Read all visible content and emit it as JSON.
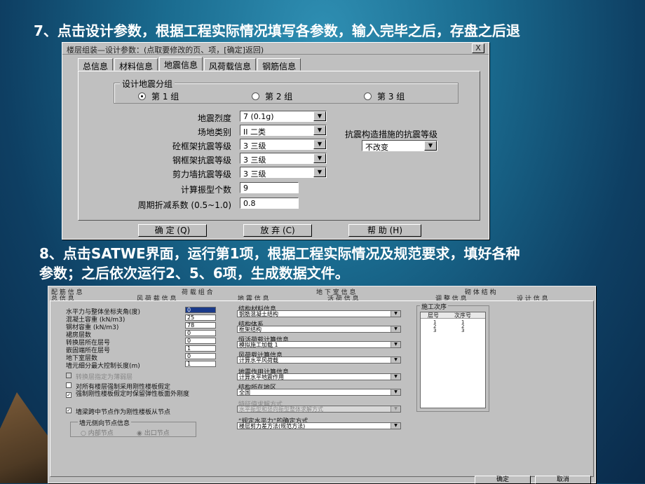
{
  "step7": "7、点击设计参数，根据工程实际情况填写各参数，输入完毕之后，存盘之后退",
  "step8_line1": "8、点击SATWE界面，运行第1项，根据工程实际情况及规范要求，填好各种",
  "step8_line2": "参数；之后依次运行2、5、6项，生成数据文件。",
  "dialog1": {
    "title": "楼层组装—设计参数：(点取要修改的页、项，[确定]返回)",
    "close": "X",
    "tabs": [
      "总信息",
      "材料信息",
      "地震信息",
      "风荷载信息",
      "钢筋信息"
    ],
    "active_tab": "地震信息",
    "group_title": "设计地震分组",
    "radios": [
      "第 1 组",
      "第 2 组",
      "第 3 组"
    ],
    "selected_radio": "第 1 组",
    "fields": [
      {
        "label": "地震烈度",
        "value": "7  (0.1g)"
      },
      {
        "label": "场地类别",
        "value": "II  二类"
      },
      {
        "label": "砼框架抗震等级",
        "value": "3   三级"
      },
      {
        "label": "钢框架抗震等级",
        "value": "3   三级"
      },
      {
        "label": "剪力墙抗震等级",
        "value": "3   三级"
      },
      {
        "label": "计算振型个数",
        "value": "9"
      },
      {
        "label": "周期折减系数 (0.5~1.0)",
        "value": "0.8"
      }
    ],
    "right_label": "抗震构造措施的抗震等级",
    "right_value": "不改变",
    "buttons": [
      "确 定 (Q)",
      "放 弃 (C)",
      "帮 助 (H)"
    ]
  },
  "dialog2": {
    "tabs_top": [
      "配 筋 信 息",
      "荷 载 组 合",
      "地 下 室 信 息",
      "砌 体 结 构"
    ],
    "tabs_bottom": [
      "总 信 息",
      "风 荷 载 信 息",
      "地 震 信 息",
      "活 荷 信 息",
      "调 整 信 息",
      "设 计 信 息"
    ],
    "left_fields": [
      {
        "label": "水平力与整体坐标夹角(度)",
        "value": "0"
      },
      {
        "label": "混凝土容重    (kN/m3)",
        "value": "25"
      },
      {
        "label": "钢材容重      (kN/m3)",
        "value": "78"
      },
      {
        "label": "裙房层数",
        "value": "0"
      },
      {
        "label": "转换层所在层号",
        "value": "0"
      },
      {
        "label": "嵌固端所在层号",
        "value": "1"
      },
      {
        "label": "地下室层数",
        "value": "0"
      },
      {
        "label": "墙元细分最大控制长度(m)",
        "value": "1"
      }
    ],
    "checks": [
      {
        "label": "转换层指定为薄弱层",
        "checked": false,
        "disabled": true
      },
      {
        "label": "对所有楼层强制采用刚性楼板假定",
        "checked": false,
        "disabled": false
      },
      {
        "label": "强制刚性楼板假定时保留弹性板面外刚度",
        "checked": true,
        "disabled": false
      },
      {
        "label": "墙梁跨中节点作为刚性楼板从节点",
        "checked": true,
        "disabled": false
      }
    ],
    "wall_group_title": "墙元侧向节点信息",
    "wall_radios": [
      "内部节点",
      "出口节点"
    ],
    "combos": [
      {
        "label": "结构材料信息",
        "value": "钢筋混凝土结构",
        "disabled": false
      },
      {
        "label": "结构体系",
        "value": "框架结构",
        "disabled": false
      },
      {
        "label": "恒活荷载计算信息",
        "value": "模拟施工加载 1",
        "disabled": false
      },
      {
        "label": "风荷载计算信息",
        "value": "计算水平风荷载",
        "disabled": false
      },
      {
        "label": "地震作用计算信息",
        "value": "计算水平地震作用",
        "disabled": false
      },
      {
        "label": "结构所在地区",
        "value": "全国",
        "disabled": false
      },
      {
        "label": "特征值求解方式",
        "value": "水平振型和竖向振型整体求解方式",
        "disabled": true
      },
      {
        "label": "“规定水平力”的确定方式",
        "value": "楼层剪力差方法(规范方法)",
        "disabled": false
      }
    ],
    "construction_title": "施工次序",
    "construction_headers": [
      "层号",
      "次序号"
    ],
    "construction_rows": [
      [
        "1",
        "1"
      ],
      [
        "2",
        "2"
      ],
      [
        "3",
        "3"
      ]
    ],
    "ok": "确定",
    "cancel": "取消"
  }
}
